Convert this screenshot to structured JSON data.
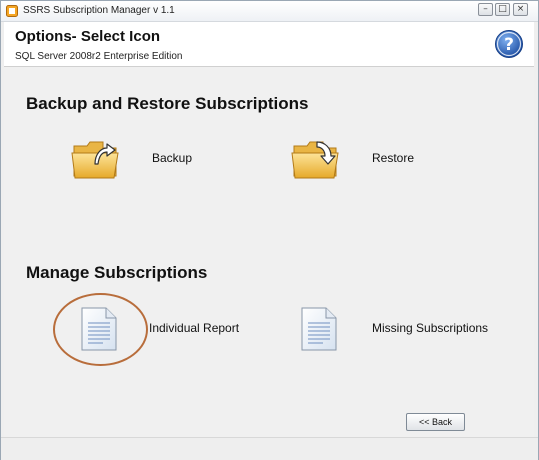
{
  "window": {
    "title": "SSRS Subscription Manager v 1.1",
    "controls": [
      "minimize",
      "maximize",
      "close"
    ]
  },
  "header": {
    "title": "Options- Select Icon",
    "subtitle": "SQL Server 2008r2 Enterprise Edition",
    "help_icon": "help-icon"
  },
  "sections": [
    {
      "title": "Backup and Restore Subscriptions",
      "options": [
        {
          "label": "Backup",
          "icon": "folder-backup-icon"
        },
        {
          "label": "Restore",
          "icon": "folder-restore-icon"
        }
      ]
    },
    {
      "title": "Manage Subscriptions",
      "options": [
        {
          "label": "Individual Report",
          "icon": "document-icon",
          "highlighted": true
        },
        {
          "label": "Missing Subscriptions",
          "icon": "document-icon"
        }
      ]
    }
  ],
  "footer": {
    "back_label": "<< Back"
  },
  "colors": {
    "highlight_circle": "#b86d3b",
    "help_blue": "#2f63b5",
    "folder_yellow": "#f2c24a"
  }
}
